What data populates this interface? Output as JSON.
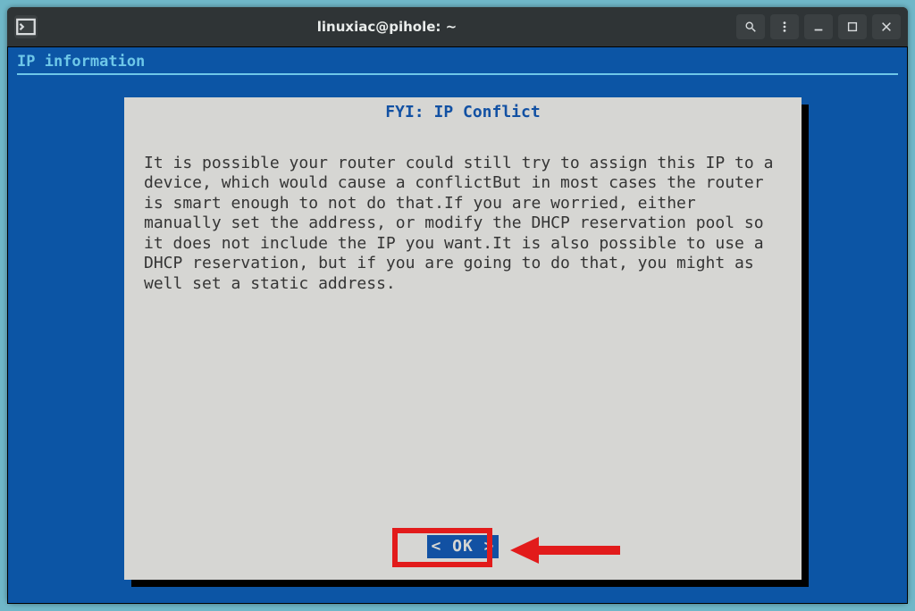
{
  "titlebar": {
    "title": "linuxiac@pihole: ~"
  },
  "terminal": {
    "section_title": "IP information"
  },
  "dialog": {
    "title": "FYI: IP Conflict",
    "body": "It is possible your router could still try to assign this IP to a device, which would cause a conflictBut in most cases the router is smart enough to not do that.If you are worried, either manually set the address, or modify the DHCP reservation pool so it does not include the IP you want.It is also possible to use a DHCP reservation, but if you are going to do that, you might as well set a static address.",
    "ok_label": "<  OK  >"
  },
  "colors": {
    "terminal_bg": "#0c55a5",
    "dialog_bg": "#d6d6d3",
    "accent_cyan": "#6ec7e8",
    "accent_blue": "#1251a3",
    "highlight_red": "#e21b1b"
  }
}
